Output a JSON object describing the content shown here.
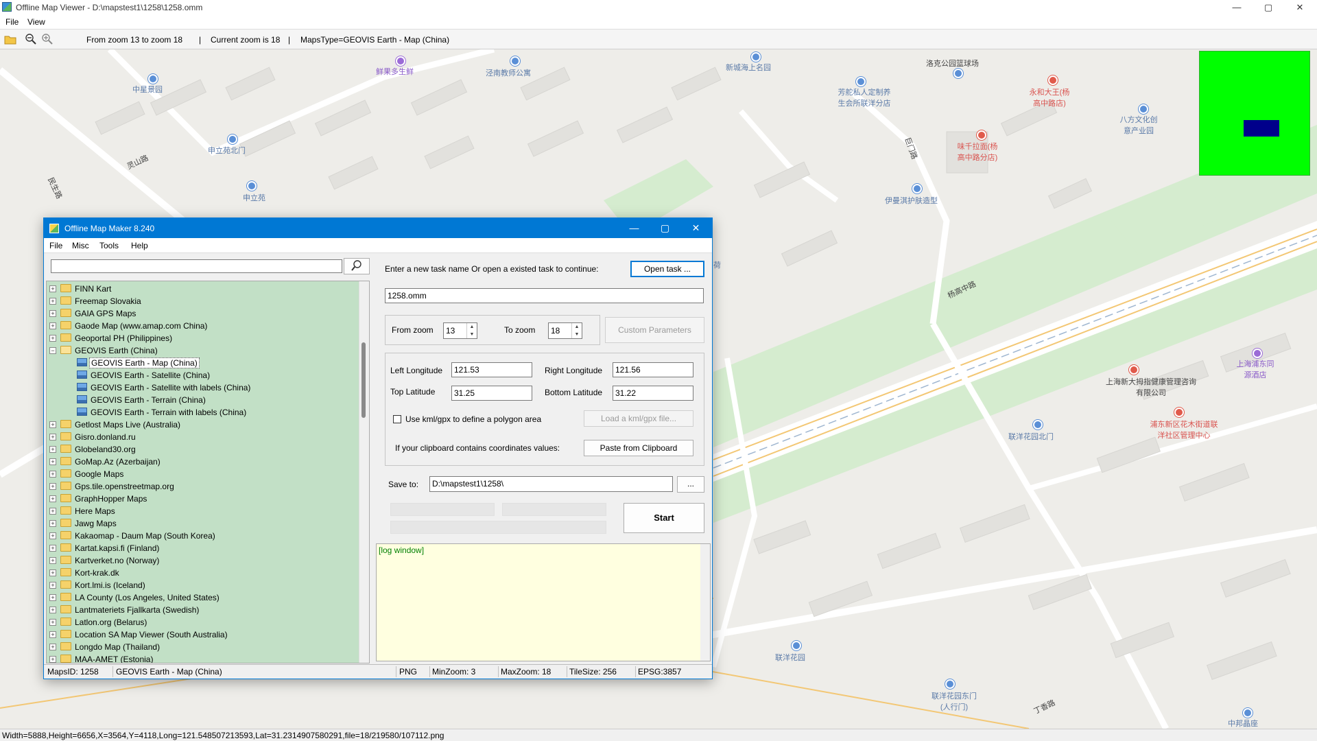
{
  "window": {
    "title": "Offline Map Viewer - D:\\mapstest1\\1258\\1258.omm",
    "minimize": "—",
    "maximize": "▢",
    "close": "✕"
  },
  "menu": [
    "File",
    "View"
  ],
  "toolbar": {
    "zoom_range": "From zoom 13 to zoom 18",
    "sep1": "|",
    "current_zoom": "Current zoom is 18",
    "sep2": "|",
    "maps_type": "MapsType=GEOVIS Earth - Map (China)"
  },
  "map_labels": [
    {
      "text": "鲜果多生鲜",
      "cls": "purple"
    },
    {
      "text": "泾南教师公寓",
      "cls": ""
    },
    {
      "text": "新城海上名园",
      "cls": ""
    },
    {
      "text": "洛克公园篮球场",
      "cls": "dark"
    },
    {
      "text": "永和大王(杨高中路店)",
      "cls": "red"
    },
    {
      "text": "中星景园",
      "cls": ""
    },
    {
      "text": "芳舵私人定制养生会所联洋分店",
      "cls": ""
    },
    {
      "text": "八方文化创意产业园",
      "cls": ""
    },
    {
      "text": "申立苑北门",
      "cls": ""
    },
    {
      "text": "味千拉面(杨高中路分店)",
      "cls": "red"
    },
    {
      "text": "灵山路",
      "cls": "dark"
    },
    {
      "text": "民生路",
      "cls": "dark"
    },
    {
      "text": "巨门路",
      "cls": "dark"
    },
    {
      "text": "申立苑",
      "cls": ""
    },
    {
      "text": "伊曼淇护肤造型",
      "cls": ""
    },
    {
      "text": "杨高中路",
      "cls": "dark"
    },
    {
      "text": "上海浦东同源酒店",
      "cls": "purple"
    },
    {
      "text": "上海新大拇指健康管理咨询有限公司",
      "cls": "dark"
    },
    {
      "text": "浦东新区花木街道联洋社区管理中心",
      "cls": "red"
    },
    {
      "text": "联洋花园北门",
      "cls": ""
    },
    {
      "text": "联洋花园",
      "cls": ""
    },
    {
      "text": "联洋花园东门(人行门)",
      "cls": ""
    },
    {
      "text": "丁香路",
      "cls": "dark"
    },
    {
      "text": "中邦晶座",
      "cls": ""
    },
    {
      "text": "荷",
      "cls": ""
    }
  ],
  "statusbar": "Width=5888,Height=6656,X=3564,Y=4118,Long=121.548507213593,Lat=31.2314907580291,file=18/219580/107112.png",
  "dialog": {
    "title": "Offline Map Maker 8.240",
    "menu": [
      "File",
      "Misc",
      "Tools",
      "Help"
    ],
    "search_value": "",
    "tree": [
      {
        "label": "FINN Kart",
        "child": false
      },
      {
        "label": "Freemap Slovakia",
        "child": false
      },
      {
        "label": "GAIA GPS Maps",
        "child": false
      },
      {
        "label": "Gaode Map (www.amap.com China)",
        "child": false
      },
      {
        "label": "Geoportal PH (Philippines)",
        "child": false
      },
      {
        "label": "GEOVIS Earth (China)",
        "child": false,
        "open": true
      },
      {
        "label": "GEOVIS Earth - Map (China)",
        "child": true,
        "selected": true
      },
      {
        "label": "GEOVIS Earth - Satellite (China)",
        "child": true
      },
      {
        "label": "GEOVIS Earth - Satellite with labels (China)",
        "child": true
      },
      {
        "label": "GEOVIS Earth - Terrain (China)",
        "child": true
      },
      {
        "label": "GEOVIS Earth - Terrain with labels (China)",
        "child": true
      },
      {
        "label": "Getlost Maps Live (Australia)",
        "child": false
      },
      {
        "label": "Gisro.donland.ru",
        "child": false
      },
      {
        "label": "Globeland30.org",
        "child": false
      },
      {
        "label": "GoMap.Az (Azerbaijan)",
        "child": false
      },
      {
        "label": "Google Maps",
        "child": false
      },
      {
        "label": "Gps.tile.openstreetmap.org",
        "child": false
      },
      {
        "label": "GraphHopper Maps",
        "child": false
      },
      {
        "label": "Here Maps",
        "child": false
      },
      {
        "label": "Jawg Maps",
        "child": false
      },
      {
        "label": "Kakaomap - Daum Map (South Korea)",
        "child": false
      },
      {
        "label": "Kartat.kapsi.fi (Finland)",
        "child": false
      },
      {
        "label": "Kartverket.no (Norway)",
        "child": false
      },
      {
        "label": "Kort-krak.dk",
        "child": false
      },
      {
        "label": "Kort.lmi.is (Iceland)",
        "child": false
      },
      {
        "label": "LA County (Los Angeles, United States)",
        "child": false
      },
      {
        "label": "Lantmateriets Fjallkarta (Swedish)",
        "child": false
      },
      {
        "label": "Latlon.org (Belarus)",
        "child": false
      },
      {
        "label": "Location SA Map Viewer (South Australia)",
        "child": false
      },
      {
        "label": "Longdo Map (Thailand)",
        "child": false
      },
      {
        "label": "MAA-AMET (Estonia)",
        "child": false
      }
    ],
    "task_prompt": "Enter a new task name Or open a existed task to continue:",
    "open_task": "Open task ...",
    "task_name": "1258.omm",
    "from_zoom_label": "From zoom",
    "from_zoom": "13",
    "to_zoom_label": "To zoom",
    "to_zoom": "18",
    "custom_params": "Custom Parameters",
    "left_lon_label": "Left Longitude",
    "left_lon": "121.53",
    "right_lon_label": "Right Longitude",
    "right_lon": "121.56",
    "top_lat_label": "Top Latitude",
    "top_lat": "31.25",
    "bottom_lat_label": "Bottom Latitude",
    "bottom_lat": "31.22",
    "kml_label": "Use kml/gpx to define a polygon area",
    "load_kml": "Load a kml/gpx file...",
    "clipboard_label": "If your clipboard contains coordinates values:",
    "paste_clipboard": "Paste from Clipboard",
    "save_to_label": "Save to:",
    "save_to": "D:\\mapstest1\\1258\\",
    "browse": "...",
    "start": "Start",
    "log": "[log window]",
    "status": {
      "maps_id": "MapsID: 1258",
      "maps_name": "GEOVIS Earth - Map (China)",
      "format": "PNG",
      "min_zoom": "MinZoom: 3",
      "max_zoom": "MaxZoom: 18",
      "tile_size": "TileSize: 256",
      "epsg": "EPSG:3857"
    }
  }
}
